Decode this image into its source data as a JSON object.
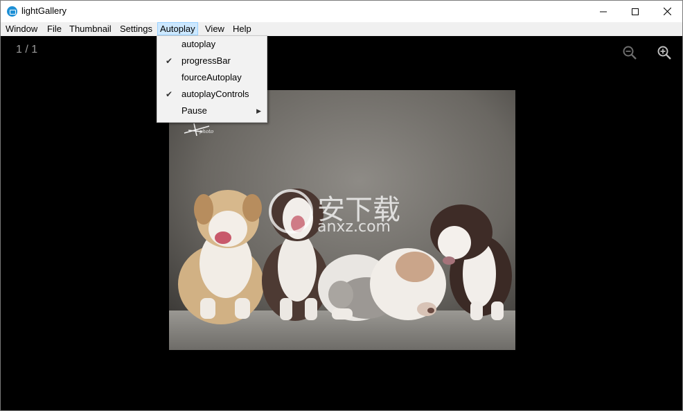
{
  "window": {
    "title": "lightGallery",
    "controls": {
      "minimize": "minimize-icon",
      "maximize": "maximize-icon",
      "close": "close-icon"
    }
  },
  "menubar": {
    "items": [
      "Window",
      "File",
      "Thumbnail",
      "Settings",
      "Autoplay",
      "View",
      "Help"
    ],
    "active": "Autoplay"
  },
  "autoplay_menu": {
    "items": [
      {
        "label": "autoplay",
        "checked": false
      },
      {
        "label": "progressBar",
        "checked": true
      },
      {
        "label": "fourceAutoplay",
        "checked": false
      },
      {
        "label": "autoplayControls",
        "checked": true
      },
      {
        "label": "Pause",
        "checked": false,
        "submenu": true
      }
    ],
    "check_glyph": "✔",
    "submenu_glyph": "▶"
  },
  "viewer": {
    "counter": "1 / 1",
    "toolbar": {
      "zoom_out": "zoom-out-icon",
      "zoom_in": "zoom-in-icon"
    },
    "photo": {
      "subject": "puppies-photo",
      "watermark_text": "安下载",
      "watermark_sub": "anxz.com",
      "signature": "photo"
    }
  },
  "colors": {
    "background": "#000000",
    "menubar": "#f0f0f0",
    "menu_highlight": "#cce8ff",
    "app_icon": "#1e90d6"
  }
}
